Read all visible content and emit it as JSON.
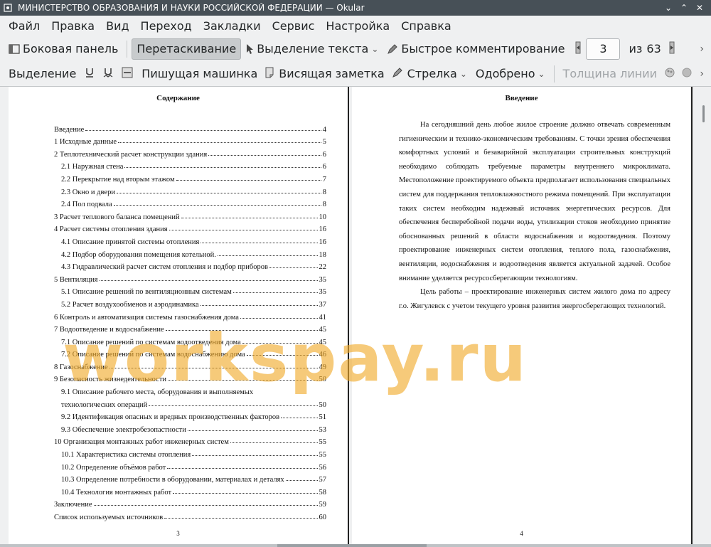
{
  "window": {
    "title": "МИНИСТЕРСТВО ОБРАЗОВАНИЯ И НАУКИ РОССИЙСКОЙ ФЕДЕРАЦИИ  — Okular",
    "minimize": "⌄",
    "maximize": "⌃",
    "close": "✕"
  },
  "menu": [
    "Файл",
    "Правка",
    "Вид",
    "Переход",
    "Закладки",
    "Сервис",
    "Настройка",
    "Справка"
  ],
  "toolbar1": {
    "sidebar_label": "Боковая панель",
    "drag_label": "Перетаскивание",
    "text_select_label": "Выделение текста",
    "quick_comment_label": "Быстрое комментирование",
    "page_current": "3",
    "page_of": "из",
    "page_total": "63"
  },
  "toolbar2": {
    "select_label": "Выделение",
    "typewriter_label": "Пишущая машинка",
    "sticky_label": "Висящая заметка",
    "arrow_label": "Стрелка",
    "approved_label": "Одобрено",
    "line_width_label": "Толщина линии"
  },
  "left_page": {
    "heading": "Содержание",
    "page_number": "3",
    "toc": [
      {
        "title": "Введение",
        "page": "4",
        "level": 1
      },
      {
        "title": "1 Исходные данные",
        "page": "5",
        "level": 1
      },
      {
        "title": "2 Теплотехнический расчет конструкции здания",
        "page": "6",
        "level": 1
      },
      {
        "title": "2.1 Наружная стена",
        "page": "6",
        "level": 2
      },
      {
        "title": "2.2 Перекрытие над вторым этажом",
        "page": "7",
        "level": 2
      },
      {
        "title": "2.3 Окно и двери",
        "page": "8",
        "level": 2
      },
      {
        "title": "2.4 Пол подвала",
        "page": "8",
        "level": 2
      },
      {
        "title": "3 Расчет теплового баланса помещений",
        "page": "10",
        "level": 1
      },
      {
        "title": "4 Расчет системы отопления здания",
        "page": "16",
        "level": 1
      },
      {
        "title": "4.1 Описание принятой системы отопления",
        "page": "16",
        "level": 2
      },
      {
        "title": "4.2 Подбор оборудования помещения котельной.",
        "page": "18",
        "level": 2
      },
      {
        "title": "4.3 Гидравлический расчет систем отопления и подбор приборов",
        "page": "22",
        "level": 2
      },
      {
        "title": "5 Вентиляция",
        "page": "35",
        "level": 1
      },
      {
        "title": "5.1 Описание решений по вентиляционным системам",
        "page": "35",
        "level": 2
      },
      {
        "title": "5.2 Расчет воздухообменов и аэродинамика",
        "page": "37",
        "level": 2
      },
      {
        "title": "6 Контроль и автоматизация системы газоснабжения дома",
        "page": "41",
        "level": 1
      },
      {
        "title": "7 Водоотведение и водоснабжение",
        "page": "45",
        "level": 1
      },
      {
        "title": "7.1 Описание решений по системам водоотведения дома",
        "page": "45",
        "level": 2
      },
      {
        "title": "7.2 Описание решений по системам водоснабжению дома",
        "page": "46",
        "level": 2
      },
      {
        "title": "8 Газоснабжение",
        "page": "49",
        "level": 1
      },
      {
        "title": "9 Безопасность жизнедеятельности",
        "page": "50",
        "level": 1
      },
      {
        "title": "9.1 Описание рабочего места, оборудования и выполняемых",
        "cont": "технологических операций",
        "page": "50",
        "level": 2
      },
      {
        "title": "9.2 Идентификация опасных и вредных производственных факторов",
        "page": "51",
        "level": 2
      },
      {
        "title": "9.3 Обеспечение электробезопастности",
        "page": "53",
        "level": 2
      },
      {
        "title": "10 Организация монтажных работ инженерных систем",
        "page": "55",
        "level": 1
      },
      {
        "title": "10.1 Характеристика системы отопления",
        "page": "55",
        "level": 2
      },
      {
        "title": "10.2 Определение объёмов работ",
        "page": "56",
        "level": 2
      },
      {
        "title": "10.3 Определение потребности в оборудовании, материалах и деталях",
        "page": "57",
        "level": 2
      },
      {
        "title": "10.4 Технология монтажных работ",
        "page": "58",
        "level": 2
      },
      {
        "title": "Заключение",
        "page": "59",
        "level": 1
      },
      {
        "title": "Список используемых источников",
        "page": "60",
        "level": 1
      }
    ]
  },
  "right_page": {
    "heading": "Введение",
    "page_number": "4",
    "paragraph1": "На сегодняшний день любое жилое строение должно отвечать современным гигиеническим и технико-экономическим требованиям. С точки зрения обеспечения комфортных условий и безаварийной эксплуатации строительных конструкций необходимо соблюдать требуемые параметры внутреннего микроклимата. Местоположение проектируемого объекта предполагает использования специальных систем для поддержания тепловлажностного режима помещений. При эксплуатации таких систем необходим надежный источник энергетических ресурсов. Для обеспечения бесперебойной подачи воды, утилизации стоков необходимо принятие обоснованных решений в области водоснабжения и водоотведения. Поэтому проектирование инженерных систем отопления, теплого пола, газоснабжения, вентиляции, водоснабжения и водоотведения является актуальной задачей. Особое внимание уделяется ресурсосберегающим технологиям.",
    "paragraph2": "Цель работы – проектирование инженерных систем жилого дома по адресу г.о. Жигулевск с учетом текущего уровня развития энергосберегающих технологий."
  },
  "watermark": "workspay.ru",
  "colors": {
    "titlebar": "#475057",
    "background": "#eff0f1",
    "active_button": "#c8cbcd",
    "watermark": "#f0aa28"
  }
}
